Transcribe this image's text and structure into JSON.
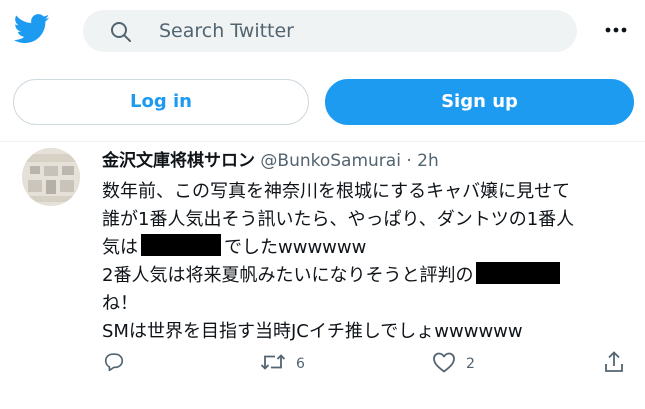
{
  "header": {
    "logo_icon": "twitter-bird-icon",
    "search_placeholder": "Search Twitter",
    "more_icon": "more-dots-icon"
  },
  "auth": {
    "login_label": "Log in",
    "signup_label": "Sign up"
  },
  "tweet": {
    "display_name": "金沢文庫将棋サロン",
    "handle": "@BunkoSamurai",
    "separator": "·",
    "time": "2h",
    "lines": [
      "数年前、この写真を神奈川を根城にするキャバ嬢に見せて",
      "誰が1番人気出そう訊いたら、やっぱり、ダントツの1番人",
      "気は",
      "でしたwwwwww",
      "2番人気は将来夏帆みたいになりそうと評判の",
      "ね！",
      "SMは世界を目指す当時JCイチ推しでしょwwwwww"
    ],
    "reply_icon": "reply-icon",
    "retweet_icon": "retweet-icon",
    "retweet_count": "6",
    "like_icon": "heart-icon",
    "like_count": "2",
    "share_icon": "share-icon"
  },
  "colors": {
    "accent": "#1d9bf0",
    "text": "#0f1419",
    "muted": "#536471",
    "search_bg": "#eff3f4",
    "border": "#cfd9de"
  }
}
